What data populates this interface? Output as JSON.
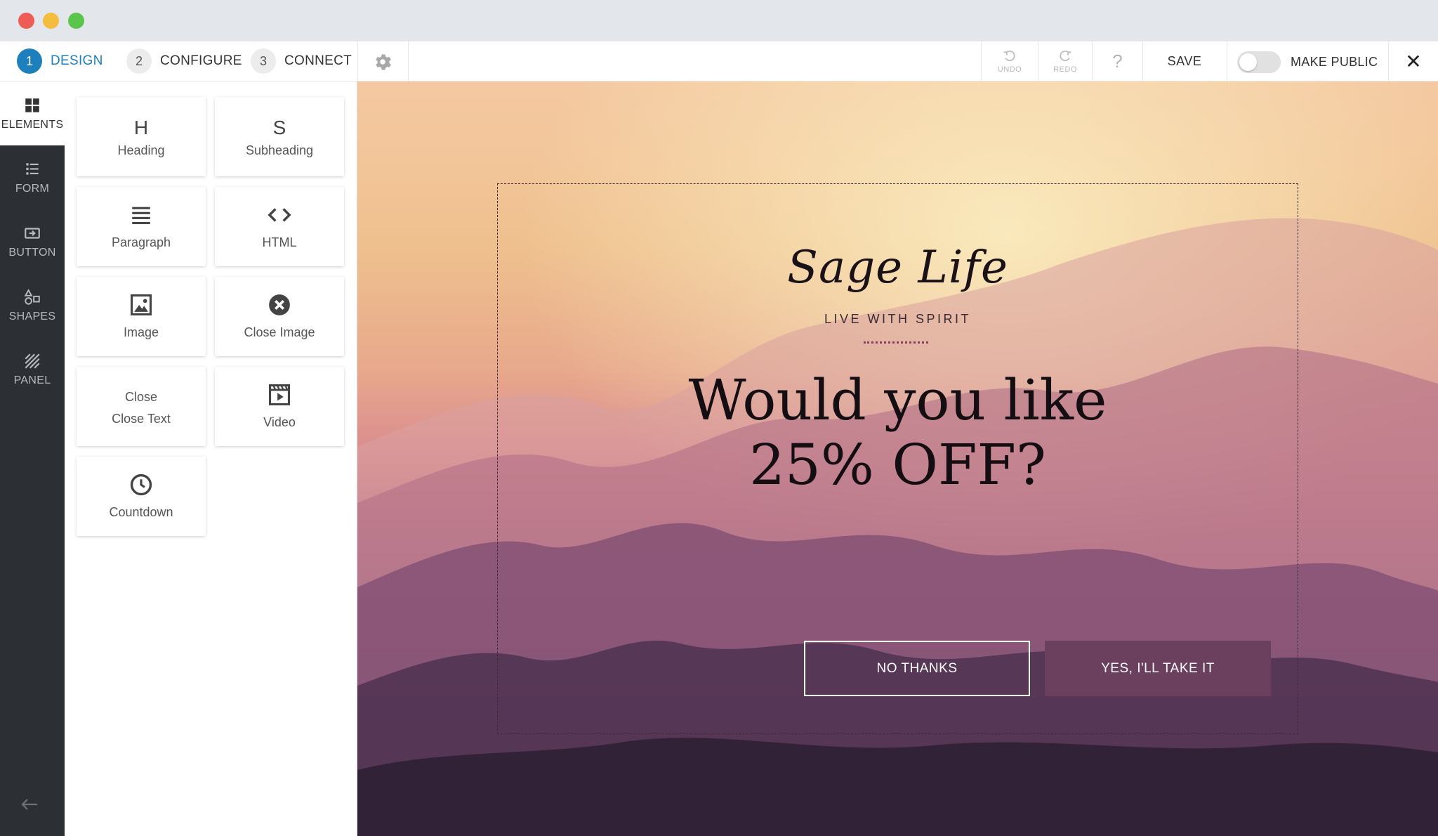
{
  "colors": {
    "accent": "#1e7fbd",
    "rail_bg": "#2c2f33",
    "cta_bg": "#6b3f5e",
    "traffic_red": "#ed5d55",
    "traffic_yellow": "#f5bd40",
    "traffic_green": "#5ac54c"
  },
  "steps": [
    {
      "num": "1",
      "label": "DESIGN",
      "active": true
    },
    {
      "num": "2",
      "label": "CONFIGURE",
      "active": false
    },
    {
      "num": "3",
      "label": "CONNECT",
      "active": false
    }
  ],
  "toolbar": {
    "undo_label": "UNDO",
    "redo_label": "REDO",
    "help_label": "?",
    "save_label": "SAVE",
    "make_public_label": "MAKE PUBLIC",
    "make_public_on": false,
    "close_label": "✕"
  },
  "rail": {
    "items": [
      {
        "label": "ELEMENTS",
        "icon": "grid-icon",
        "active": true
      },
      {
        "label": "FORM",
        "icon": "form-icon",
        "active": false
      },
      {
        "label": "BUTTON",
        "icon": "button-icon",
        "active": false
      },
      {
        "label": "SHAPES",
        "icon": "shapes-icon",
        "active": false
      },
      {
        "label": "PANEL",
        "icon": "panel-icon",
        "active": false
      }
    ],
    "back_icon": "arrow-left-icon"
  },
  "elements": [
    {
      "label": "Heading",
      "glyph": "H",
      "icon": "heading-icon"
    },
    {
      "label": "Subheading",
      "glyph": "S",
      "icon": "subheading-icon"
    },
    {
      "label": "Paragraph",
      "icon": "paragraph-icon"
    },
    {
      "label": "HTML",
      "icon": "code-icon"
    },
    {
      "label": "Image",
      "icon": "image-icon"
    },
    {
      "label": "Close Image",
      "icon": "close-circle-icon"
    },
    {
      "label": "Close Text",
      "glyph": "Close",
      "icon": "close-text-icon"
    },
    {
      "label": "Video",
      "icon": "video-icon"
    },
    {
      "label": "Countdown",
      "icon": "clock-icon"
    }
  ],
  "popup": {
    "logo": "Sage Life",
    "tagline": "LIVE WITH SPIRIT",
    "headline_line1": "Would you like",
    "headline_line2": "25% OFF?",
    "no_button": "NO THANKS",
    "yes_button": "YES, I'LL TAKE IT"
  }
}
